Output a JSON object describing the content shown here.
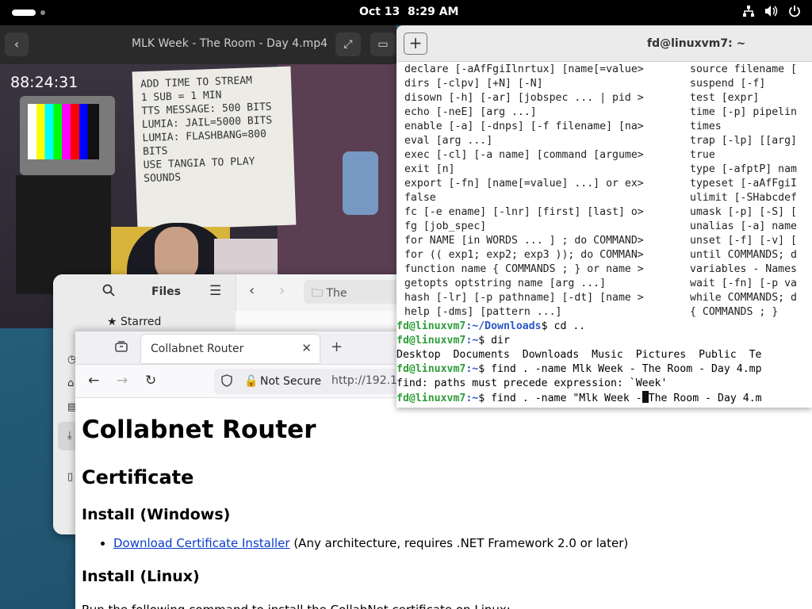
{
  "topbar": {
    "date": "Oct 13",
    "time": "8:29 AM",
    "icons": [
      "network-icon",
      "volume-icon",
      "power-icon"
    ]
  },
  "video": {
    "title": "MLK Week - The Room - Day 4.mp4",
    "timer": "88:24:31",
    "poster_lines": [
      "ADD TIME TO STREAM",
      "1 SUB = 1 MIN",
      "TTS MESSAGE: 500 BITS",
      "LUMIA: JAIL=5000 BITS",
      "LUMIA: FLASHBANG=800 BITS",
      "USE TANGIA TO PLAY SOUNDS"
    ]
  },
  "files": {
    "title": "Files",
    "sidebar_item": "Starred",
    "path": "The"
  },
  "firefox": {
    "tab_title": "Collabnet Router",
    "not_secure": "Not Secure",
    "url": "http://192.16",
    "page": {
      "h1": "Collabnet Router",
      "h2": "Certificate",
      "h3_windows": "Install (Windows)",
      "link": "Download Certificate Installer",
      "link_suffix": " (Any architecture, requires .NET Framework 2.0 or later)",
      "h3_linux": "Install (Linux)",
      "paragraph": "Run the following command to install the CollabNet certificate on Linux:"
    }
  },
  "terminal": {
    "title": "fd@linuxvm7: ~",
    "left_column": [
      "declare [-aAfFgiIlnrtux] [name[=value>",
      "dirs [-clpv] [+N] [-N]",
      "disown [-h] [-ar] [jobspec ... | pid >",
      "echo [-neE] [arg ...]",
      "enable [-a] [-dnps] [-f filename] [na>",
      "eval [arg ...]",
      "exec [-cl] [-a name] [command [argume>",
      "exit [n]",
      "export [-fn] [name[=value] ...] or ex>",
      "false",
      "fc [-e ename] [-lnr] [first] [last] o>",
      "fg [job_spec]",
      "for NAME [in WORDS ... ] ; do COMMAND>",
      "for (( exp1; exp2; exp3 )); do COMMAN>",
      "function name { COMMANDS ; } or name >",
      "getopts optstring name [arg ...]",
      "hash [-lr] [-p pathname] [-dt] [name >",
      "help [-dms] [pattern ...]"
    ],
    "right_column": [
      "source filename [",
      "suspend [-f]",
      "test [expr]",
      "time [-p] pipelin",
      "times",
      "trap [-lp] [[arg]",
      "true",
      "type [-afptP] nam",
      "typeset [-aAfFgiI",
      "ulimit [-SHabcdef",
      "umask [-p] [-S] [",
      "unalias [-a] name",
      "unset [-f] [-v] [",
      "until COMMANDS; d",
      "variables - Names",
      "wait [-fn] [-p va",
      "while COMMANDS; d",
      "{ COMMANDS ; }"
    ],
    "prompt_user": "fd@linuxvm7",
    "lines": {
      "p1_path": ":~/Downloads",
      "p1_cmd": "$ cd ..",
      "p2_path": ":~",
      "p2_cmd": "$ dir",
      "dir_output": "Desktop  Documents  Downloads  Music  Pictures  Public  Te",
      "p3_path": ":~",
      "p3_cmd": "$ find . -name Mlk Week - The Room - Day 4.mp",
      "error": "find: paths must precede expression: `Week'",
      "p4_path": ":~",
      "p4_cmd_before": "$ find . -name \"Mlk Week -",
      "p4_cmd_after": "The Room - Day 4.m"
    }
  }
}
